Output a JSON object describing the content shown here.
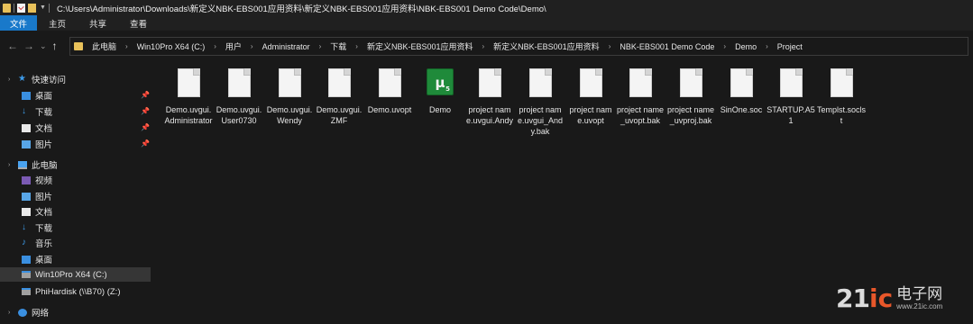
{
  "window": {
    "title_path": "C:\\Users\\Administrator\\Downloads\\新定义NBK-EBS001应用资料\\新定义NBK-EBS001应用资料\\NBK-EBS001 Demo Code\\Demo\\"
  },
  "ribbon": {
    "tabs": [
      "文件",
      "主页",
      "共享",
      "查看"
    ]
  },
  "nav_buttons": {
    "back": "←",
    "forward": "→",
    "dropdown": "⌄",
    "up": "↑"
  },
  "address": {
    "crumbs": [
      "此电脑",
      "Win10Pro X64 (C:)",
      "用户",
      "Administrator",
      "下载",
      "新定义NBK-EBS001应用资料",
      "新定义NBK-EBS001应用资料",
      "NBK-EBS001 Demo Code",
      "Demo",
      "Project"
    ]
  },
  "navpane": {
    "quick_access": "快速访问",
    "quick_items": [
      "桌面",
      "下载",
      "文档",
      "图片"
    ],
    "this_pc": "此电脑",
    "pc_items": [
      "视频",
      "图片",
      "文档",
      "下载",
      "音乐",
      "桌面"
    ],
    "drive_c": "Win10Pro X64 (C:)",
    "drive_z": "PhiHardisk (\\\\B70) (Z:)",
    "network": "网络"
  },
  "files": [
    {
      "name": "Demo.uvgui.Administrator",
      "icon": "generic-file-icon"
    },
    {
      "name": "Demo.uvgui.User0730",
      "icon": "generic-file-icon"
    },
    {
      "name": "Demo.uvgui.Wendy",
      "icon": "generic-file-icon"
    },
    {
      "name": "Demo.uvgui.ZMF",
      "icon": "generic-file-icon"
    },
    {
      "name": "Demo.uvopt",
      "icon": "generic-file-icon"
    },
    {
      "name": "Demo",
      "icon": "uvision5-project-icon"
    },
    {
      "name": "project name.uvgui.Andy",
      "icon": "generic-file-icon"
    },
    {
      "name": "project name.uvgui_Andy.bak",
      "icon": "generic-file-icon"
    },
    {
      "name": "project name.uvopt",
      "icon": "generic-file-icon"
    },
    {
      "name": "project name_uvopt.bak",
      "icon": "generic-file-icon"
    },
    {
      "name": "project name_uvproj.bak",
      "icon": "generic-file-icon"
    },
    {
      "name": "SinOne.soc",
      "icon": "generic-file-icon"
    },
    {
      "name": "STARTUP.A51",
      "icon": "generic-file-icon"
    },
    {
      "name": "Templst.soclst",
      "icon": "generic-file-icon"
    }
  ],
  "uv_icon": {
    "letter": "µ",
    "version": "5"
  },
  "watermark": {
    "brand_num": "21",
    "brand_ic": "ic",
    "brand_cn": "电子网",
    "url": "www.21ic.com"
  },
  "colors": {
    "accent": "#1979ca",
    "background": "#191919",
    "folder": "#e8c15a",
    "uvision_green": "#1f8a3a"
  }
}
